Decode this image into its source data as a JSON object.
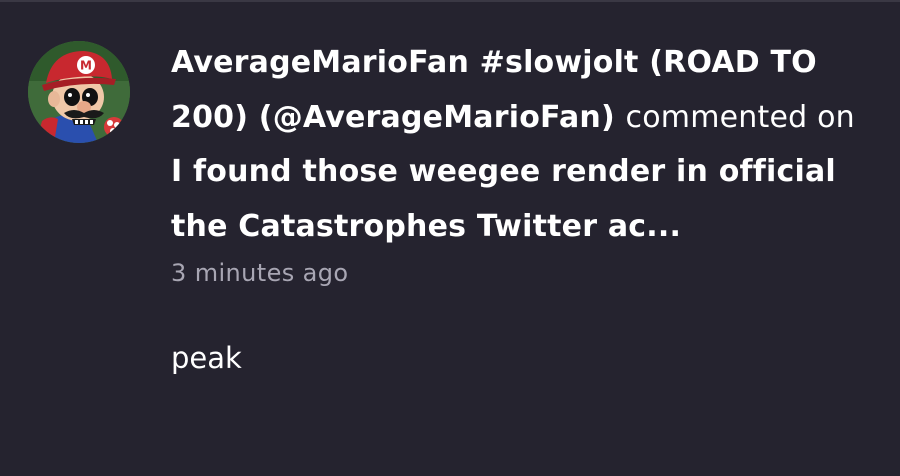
{
  "notification": {
    "user_display_name": "AverageMarioFan #slowjolt (ROAD TO 200)",
    "user_handle": "(@AverageMarioFan)",
    "action_text": "commented on",
    "post_title": "I found those weegee render in official the Catastrophes Twitter ac...",
    "timestamp": "3 minutes ago",
    "comment_text": "peak"
  },
  "colors": {
    "background": "#25232f",
    "text_primary": "#ffffff",
    "text_secondary": "#a8a6b3"
  },
  "avatar": {
    "icon": "mario-avatar-icon"
  }
}
